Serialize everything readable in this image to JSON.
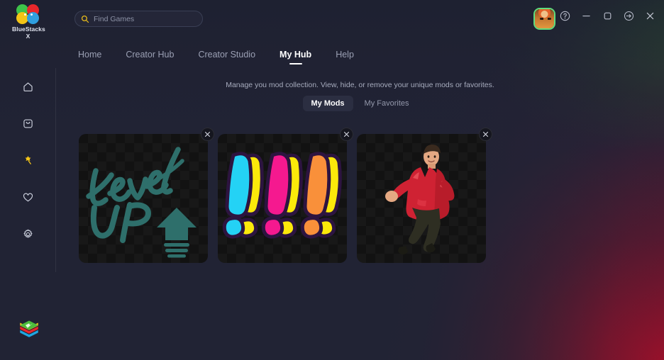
{
  "app": {
    "brand_name": "BlueStacks X",
    "logo_icon": "bluestacks-petals-logo",
    "bottom_logo_icon": "bluestacks-stack-logo"
  },
  "search": {
    "placeholder": "Find Games",
    "value": "",
    "icon": "search-icon"
  },
  "window_controls": [
    {
      "name": "help-button",
      "icon": "question-circle-icon"
    },
    {
      "name": "minimize-button",
      "icon": "minimize-icon"
    },
    {
      "name": "maximize-button",
      "icon": "maximize-square-icon"
    },
    {
      "name": "exit-to-app-button",
      "icon": "arrow-right-circle-icon"
    },
    {
      "name": "close-button",
      "icon": "close-x-icon"
    }
  ],
  "avatar": {
    "name": "user-avatar",
    "alt": "profile-picture"
  },
  "nav": {
    "tabs": [
      {
        "label": "Home",
        "active": false
      },
      {
        "label": "Creator Hub",
        "active": false
      },
      {
        "label": "Creator Studio",
        "active": false
      },
      {
        "label": "My Hub",
        "active": true
      },
      {
        "label": "Help",
        "active": false
      }
    ]
  },
  "sidebar": {
    "items": [
      {
        "name": "sidebar-item-home",
        "icon": "home-icon",
        "active": false
      },
      {
        "name": "sidebar-item-apps",
        "icon": "app-store-bag-icon",
        "active": false
      },
      {
        "name": "sidebar-item-mods",
        "icon": "magic-wand-icon",
        "active": true
      },
      {
        "name": "sidebar-item-favorites",
        "icon": "heart-icon",
        "active": false
      },
      {
        "name": "sidebar-item-settings",
        "icon": "gear-icon",
        "active": false
      }
    ]
  },
  "main": {
    "subtitle": "Manage you mod collection. View, hide, or remove your unique mods or favorites.",
    "segments": [
      {
        "label": "My Mods",
        "active": true
      },
      {
        "label": "My Favorites",
        "active": false
      }
    ],
    "cards": [
      {
        "name": "mod-card-level-up",
        "art": "level-up-arrow",
        "close_icon": "close-x-icon",
        "art_text_line1": "Level",
        "art_text_line2": "UP",
        "art_color": "#2e6f6b"
      },
      {
        "name": "mod-card-exclamations",
        "art": "three-exclamation-marks",
        "close_icon": "close-x-icon",
        "colors": [
          "#24d2f5",
          "#f5198f",
          "#f9903a"
        ],
        "shadow_color": "#fbe90a",
        "outline_color": "#2d1440"
      },
      {
        "name": "mod-card-dancer",
        "art": "dancing-man-red-jacket",
        "close_icon": "close-x-icon",
        "jacket_color": "#cf2233",
        "pants_color": "#2e2e22"
      }
    ]
  },
  "theme": {
    "accent_yellow": "#f5c518",
    "surface": "#212334",
    "bg_green": "#2e5c30",
    "bg_crimson": "#9c102a",
    "bg_navy": "#1b2236"
  }
}
